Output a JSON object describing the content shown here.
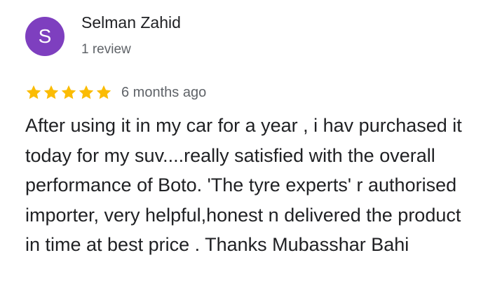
{
  "reviewer": {
    "avatar_letter": "S",
    "avatar_color": "#7e3fbf",
    "name": "Selman Zahid",
    "review_count": "1 review"
  },
  "rating": {
    "stars": 5,
    "max_stars": 5,
    "star_color": "#fbbc04",
    "star_icon": "star-icon",
    "time_ago": "6 months ago"
  },
  "review": {
    "text": "After using it in my car for a year , i hav purchased it today for my suv....really satisfied with the overall performance of Boto. 'The tyre experts' r authorised importer, very helpful,honest n delivered the product in time at best price . Thanks Mubasshar Bahi"
  }
}
